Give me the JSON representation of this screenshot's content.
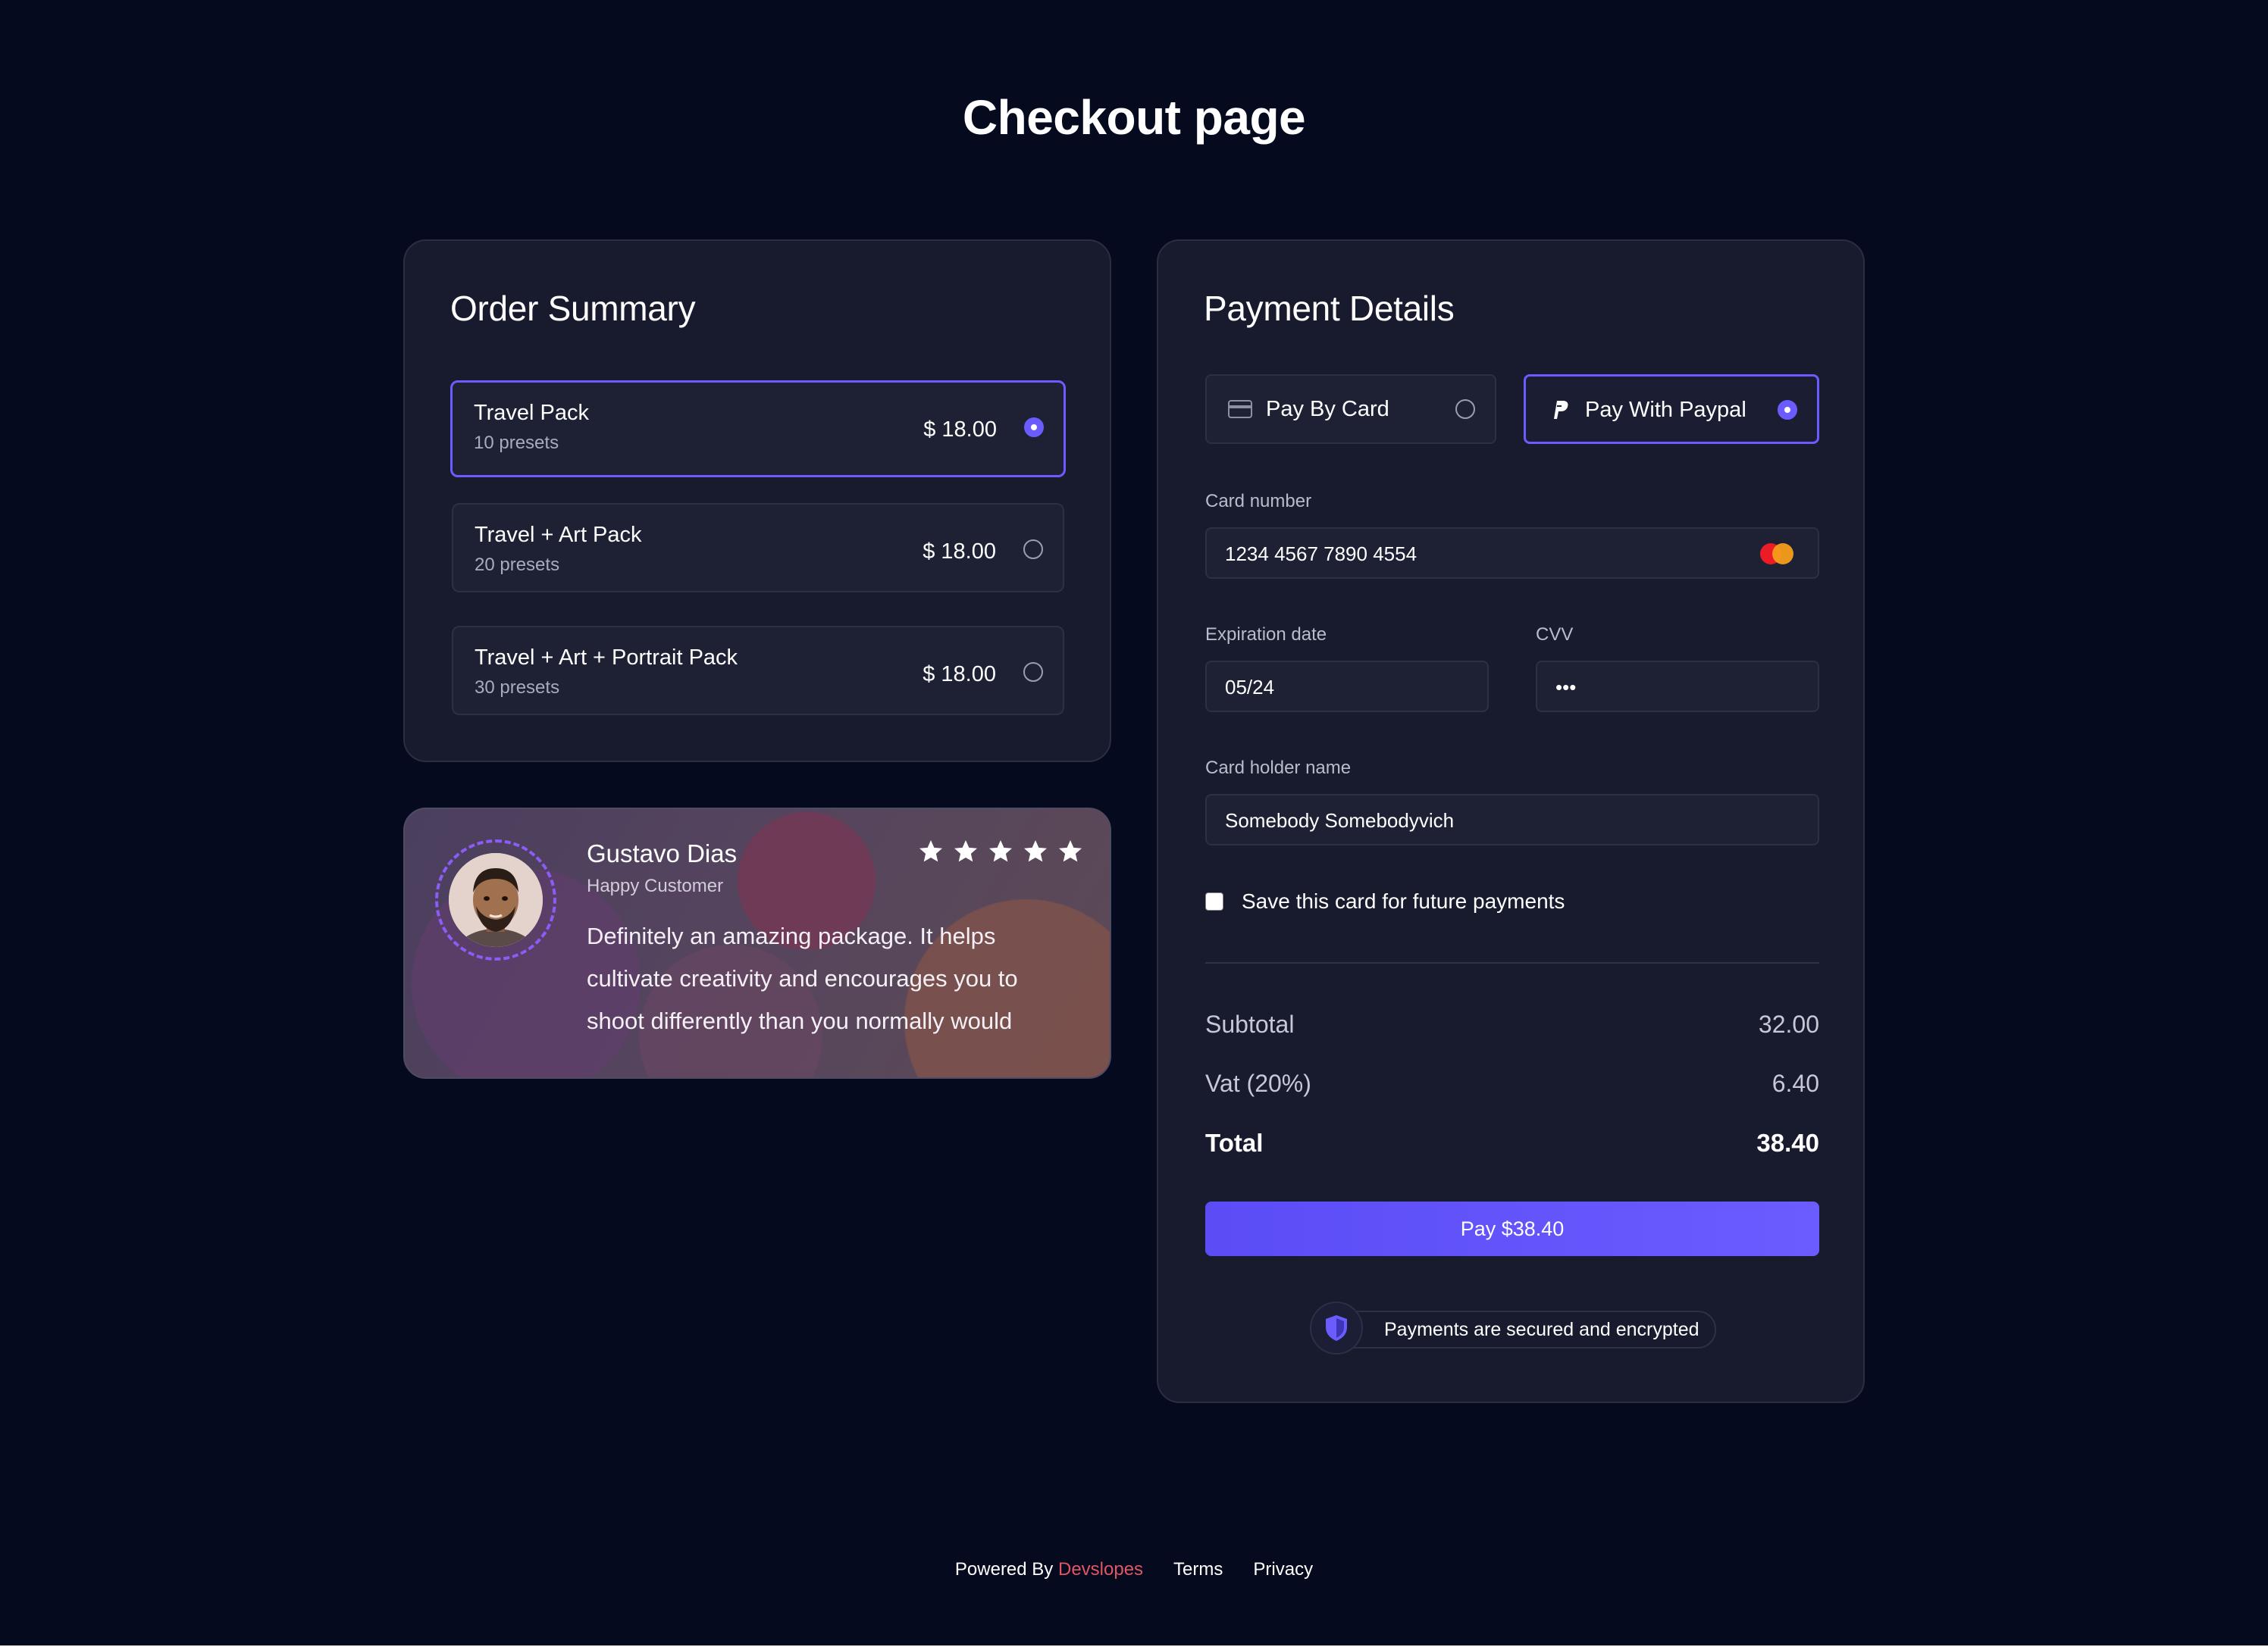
{
  "page": {
    "title": "Checkout page"
  },
  "order": {
    "title": "Order Summary",
    "plans": [
      {
        "name": "Travel Pack",
        "presets": "10 presets",
        "price": "$ 18.00",
        "selected": true
      },
      {
        "name": "Travel + Art Pack",
        "presets": "20 presets",
        "price": "$ 18.00",
        "selected": false
      },
      {
        "name": "Travel + Art + Portrait Pack",
        "presets": "30 presets",
        "price": "$ 18.00",
        "selected": false
      }
    ]
  },
  "testimonial": {
    "name": "Gustavo Dias",
    "role": "Happy Customer",
    "text": "Definitely an amazing package. It helps cultivate creativity and encourages you to shoot differently than you normally would",
    "rating": 5
  },
  "payment": {
    "title": "Payment Details",
    "methods": [
      {
        "label": "Pay By Card",
        "icon": "credit-card-icon",
        "selected": false
      },
      {
        "label": "Pay With Paypal",
        "icon": "paypal-icon",
        "selected": true
      }
    ],
    "card_number": {
      "label": "Card number",
      "value": "1234 4567 7890 4554",
      "brand_icon": "mastercard-icon"
    },
    "expiration": {
      "label": "Expiration date",
      "value": "05/24"
    },
    "cvv": {
      "label": "CVV",
      "value": "•••"
    },
    "holder": {
      "label": "Card holder name",
      "value": "Somebody Somebodyvich"
    },
    "save_card": {
      "label": "Save this card for future payments",
      "checked": false
    },
    "summary": {
      "subtotal_label": "Subtotal",
      "subtotal": "32.00",
      "vat_label": "Vat (20%)",
      "vat": "6.40",
      "total_label": "Total",
      "total": "38.40"
    },
    "pay_button": "Pay $38.40",
    "secure_note": "Payments are secured and encrypted"
  },
  "footer": {
    "powered_by": "Powered By",
    "brand": "Devslopes",
    "terms": "Terms",
    "privacy": "Privacy"
  },
  "colors": {
    "background": "#050a1e",
    "card": "#181a2e",
    "accent": "#6b5cff",
    "brand": "#e05663"
  }
}
